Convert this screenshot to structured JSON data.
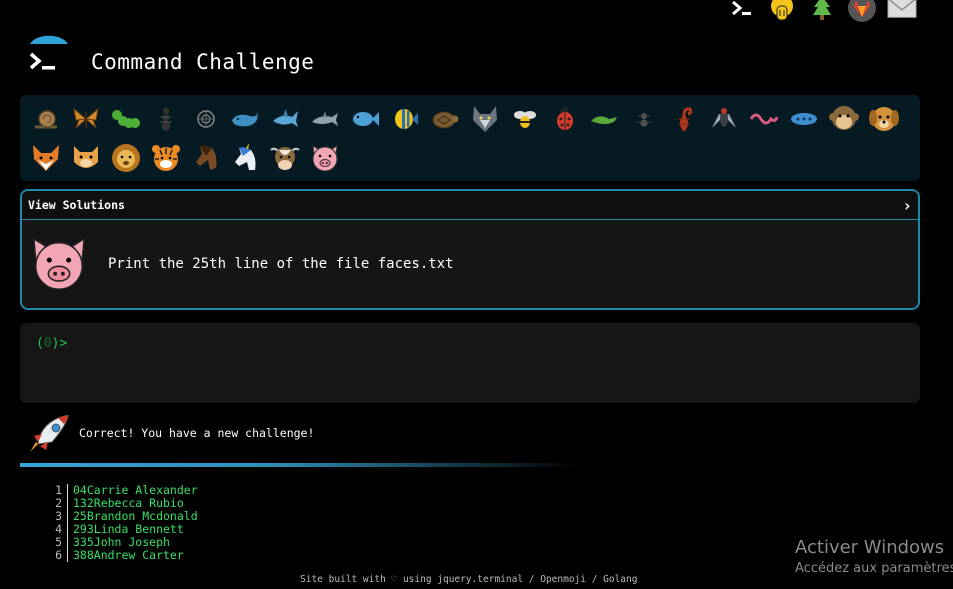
{
  "header": {
    "title": "Command Challenge",
    "top_icons": [
      "terminal-icon",
      "hand-icon",
      "tree-icon",
      "gitlab-icon",
      "mail-icon"
    ]
  },
  "animals": {
    "row1": [
      "snail",
      "butterfly",
      "caterpillar",
      "ant",
      "spiral-shell",
      "whale",
      "shark",
      "dolphin",
      "fish",
      "tropical-fish",
      "turtle",
      "wolf",
      "bee",
      "ladybug",
      "lizard",
      "spider",
      "scorpion",
      "fly",
      "worm",
      "microbe",
      "monkey",
      "dog"
    ],
    "row2": [
      "fox",
      "cat",
      "lion",
      "tiger",
      "horse",
      "unicorn",
      "cow",
      "pig"
    ]
  },
  "challenge": {
    "view_solutions": "View Solutions",
    "chevron": "›",
    "text": "Print the 25th line of the file faces.txt"
  },
  "terminal": {
    "prompt_open": "(",
    "prompt_num": "0",
    "prompt_close": ")>"
  },
  "result": {
    "message": "Correct! You have a new challenge!"
  },
  "listing": {
    "lines": [
      {
        "n": "1",
        "text": "04Carrie Alexander"
      },
      {
        "n": "2",
        "text": "132Rebecca Rubio"
      },
      {
        "n": "3",
        "text": "25Brandon Mcdonald"
      },
      {
        "n": "4",
        "text": "293Linda Bennett"
      },
      {
        "n": "5",
        "text": "335John Joseph"
      },
      {
        "n": "6",
        "text": "388Andrew Carter"
      }
    ]
  },
  "footer": "Site built with ♡ using jquery.terminal / Openmoji / Golang",
  "windows": {
    "line1": "Activer Windows",
    "line2": "Accédez aux paramètres"
  },
  "colors": {
    "accent": "#1b88a8",
    "prompt_green": "#22c24a",
    "listing_green": "#38e066",
    "animal_bar_bg": "#051a22"
  }
}
